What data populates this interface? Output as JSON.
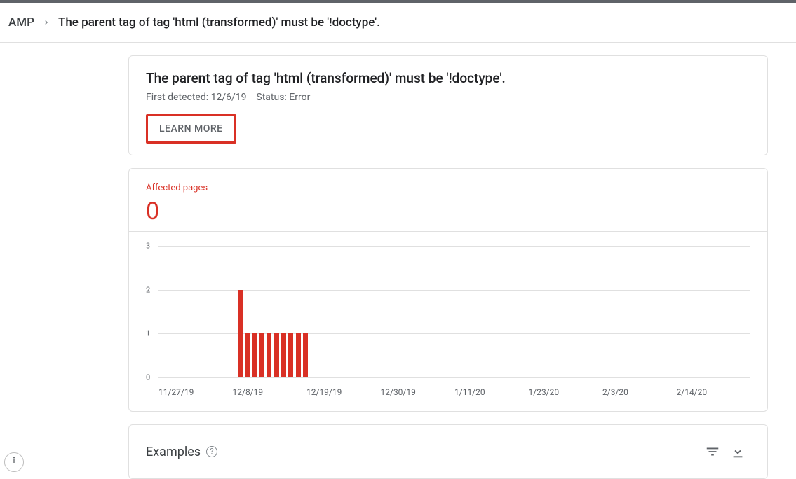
{
  "breadcrumb": {
    "root": "AMP",
    "title": "The parent tag of tag 'html (transformed)' must be '!doctype'."
  },
  "issue": {
    "title": "The parent tag of tag 'html (transformed)' must be '!doctype'.",
    "first_detected_label": "First detected:",
    "first_detected_value": "12/6/19",
    "status_label": "Status:",
    "status_value": "Error",
    "learn_more": "LEARN MORE"
  },
  "affected": {
    "label": "Affected pages",
    "count": "0"
  },
  "chart_data": {
    "type": "bar",
    "title": "",
    "xlabel": "",
    "ylabel": "",
    "ylim": [
      0,
      3
    ],
    "yticks": [
      0,
      1,
      2,
      3
    ],
    "x_tick_labels": [
      "11/27/19",
      "12/8/19",
      "12/19/19",
      "12/30/19",
      "1/11/20",
      "1/23/20",
      "2/3/20",
      "2/14/20"
    ],
    "total_days": 82,
    "bars": [
      {
        "day_index": 11,
        "value": 2
      },
      {
        "day_index": 12,
        "value": 1
      },
      {
        "day_index": 13,
        "value": 1
      },
      {
        "day_index": 14,
        "value": 1
      },
      {
        "day_index": 15,
        "value": 1
      },
      {
        "day_index": 16,
        "value": 1
      },
      {
        "day_index": 17,
        "value": 1
      },
      {
        "day_index": 18,
        "value": 1
      },
      {
        "day_index": 19,
        "value": 1
      },
      {
        "day_index": 20,
        "value": 1
      }
    ]
  },
  "examples": {
    "title": "Examples"
  }
}
